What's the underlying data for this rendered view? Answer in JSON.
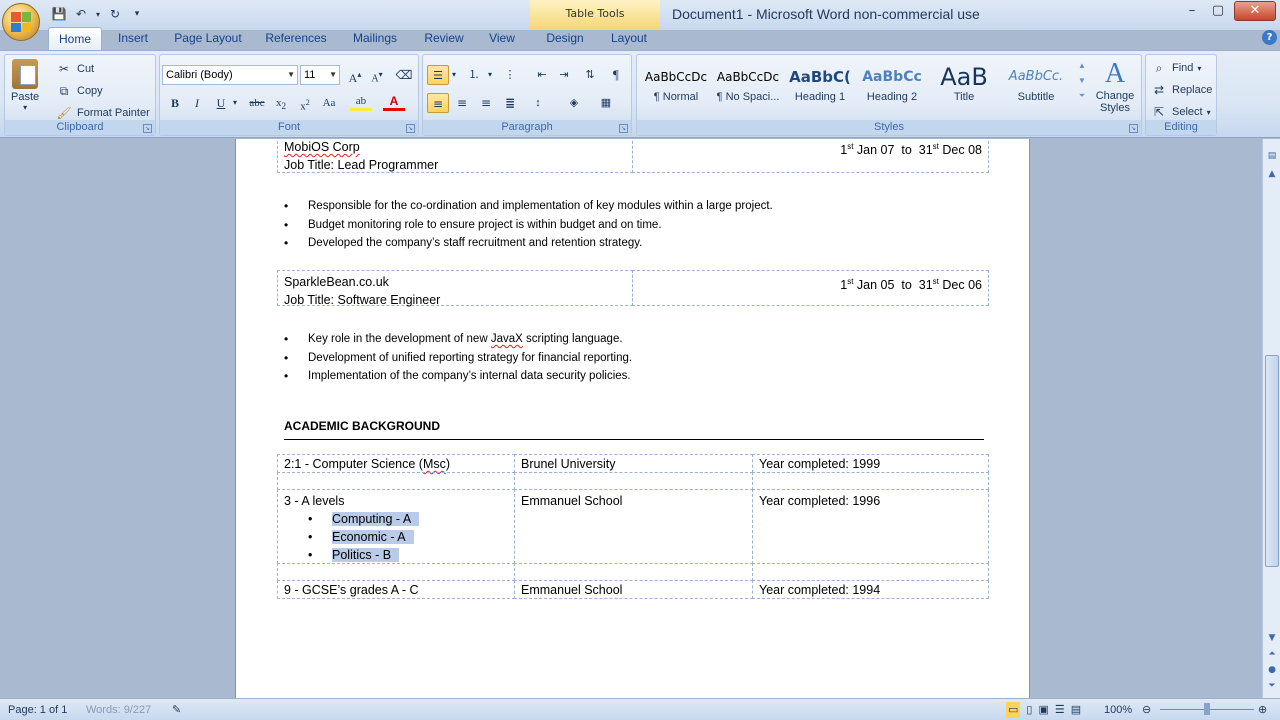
{
  "window": {
    "title": "Document1 - Microsoft Word non-commercial use",
    "contextual_tab_group": "Table Tools",
    "controls": {
      "minimize": "–",
      "maximize": "▢",
      "close": "✕"
    }
  },
  "quick_access": {
    "save": "💾",
    "undo": "↶",
    "redo": "↻",
    "customize": "▾"
  },
  "tabs": [
    "Home",
    "Insert",
    "Page Layout",
    "References",
    "Mailings",
    "Review",
    "View",
    "Design",
    "Layout"
  ],
  "active_tab": "Home",
  "ribbon": {
    "clipboard": {
      "label": "Clipboard",
      "paste": "Paste",
      "cut": "Cut",
      "copy": "Copy",
      "format_painter": "Format Painter"
    },
    "font": {
      "label": "Font",
      "font_name": "Calibri (Body)",
      "font_size": "11"
    },
    "paragraph": {
      "label": "Paragraph"
    },
    "styles": {
      "label": "Styles",
      "items": [
        {
          "preview": "AaBbCcDc",
          "name": "¶ Normal"
        },
        {
          "preview": "AaBbCcDc",
          "name": "¶ No Spaci..."
        },
        {
          "preview": "AaBbC(",
          "name": "Heading 1"
        },
        {
          "preview": "AaBbCc",
          "name": "Heading 2"
        },
        {
          "preview": "AaB",
          "name": "Title"
        },
        {
          "preview": "AaBbCc.",
          "name": "Subtitle"
        }
      ],
      "change_styles": "Change Styles"
    },
    "editing": {
      "label": "Editing",
      "find": "Find",
      "replace": "Replace",
      "select": "Select"
    }
  },
  "document": {
    "jobs": [
      {
        "company": "MobiOS Corp",
        "title": "Job Title: Lead Programmer",
        "date": {
          "d1": "1",
          "s1": "st",
          "m1": " Jan 07  to  31",
          "s2": "st",
          "m2": " Dec 08"
        },
        "bullets": [
          "Responsible for the co-ordination and implementation  of key modules within a large project.",
          "Budget monitoring role to ensure project is within budget and on time.",
          "Developed the company’s staff recruitment and retention strategy."
        ]
      },
      {
        "company": "SparkleBean.co.uk",
        "title": "Job Title: Software Engineer",
        "date": {
          "d1": "1",
          "s1": "st",
          "m1": " Jan 05  to  31",
          "s2": "st",
          "m2": " Dec 06"
        },
        "bullets": [
          "Key role in the development of new JavaX scripting language.",
          "Development of unified reporting strategy for financial reporting.",
          "Implementation of the company’s internal data security policies."
        ]
      }
    ],
    "academic_heading": "ACADEMIC BACKGROUND",
    "academic": [
      {
        "qual": "2:1 - Computer Science (Msc)",
        "institution": "Brunel University",
        "year": "Year completed: 1999"
      },
      {
        "qual": "3 - A levels",
        "institution": "Emmanuel School",
        "year": "Year completed: 1996",
        "subjects": [
          "Computing - A",
          "Economic - A",
          "Politics - B"
        ]
      },
      {
        "qual": "9 - GCSE’s grades A - C",
        "institution": "Emmanuel School",
        "year": "Year completed: 1994"
      }
    ]
  },
  "statusbar": {
    "page": "Page: 1 of 1",
    "words": "Words: 9/227",
    "zoom": "100%"
  }
}
